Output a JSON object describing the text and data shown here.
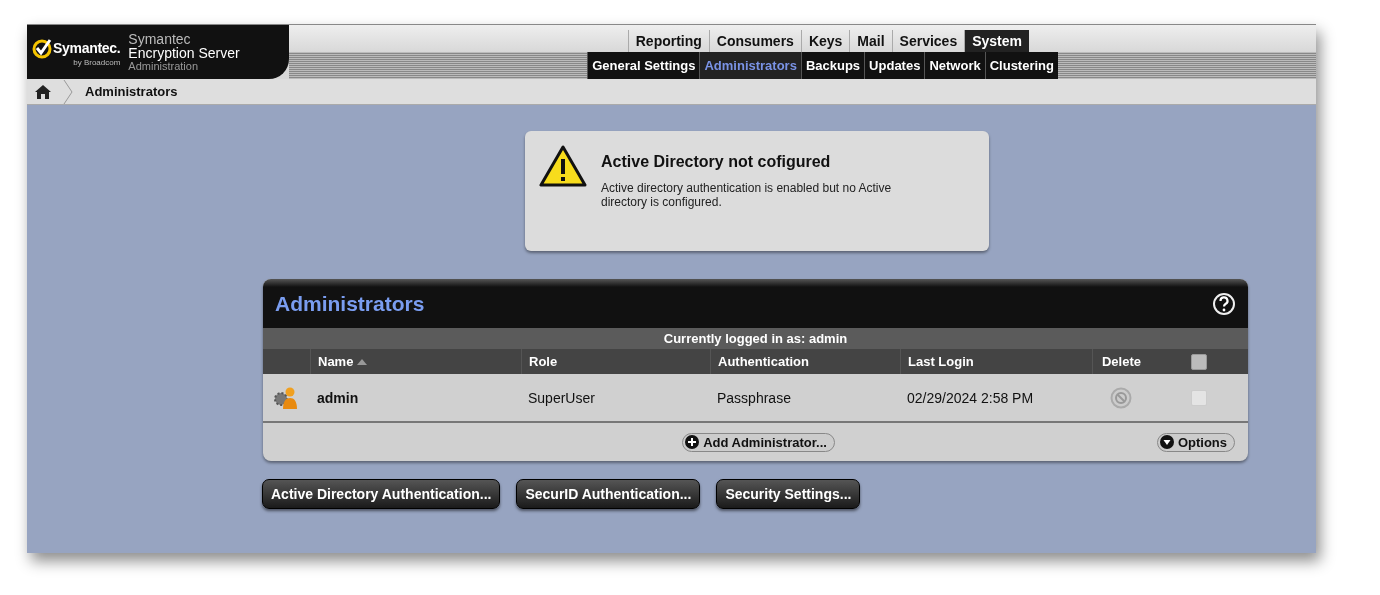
{
  "header": {
    "logo": {
      "brand": "Symantec.",
      "tagline": "by Broadcom"
    },
    "product": {
      "vendor": "Symantec",
      "name": "Encryption Server",
      "subtitle": "Administration"
    }
  },
  "tabs": [
    {
      "label": "Reporting",
      "selected": false
    },
    {
      "label": "Consumers",
      "selected": false
    },
    {
      "label": "Keys",
      "selected": false
    },
    {
      "label": "Mail",
      "selected": false
    },
    {
      "label": "Services",
      "selected": false
    },
    {
      "label": "System",
      "selected": true
    }
  ],
  "subtabs": [
    {
      "label": "General Settings",
      "selected": false
    },
    {
      "label": "Administrators",
      "selected": true
    },
    {
      "label": "Backups",
      "selected": false
    },
    {
      "label": "Updates",
      "selected": false
    },
    {
      "label": "Network",
      "selected": false
    },
    {
      "label": "Clustering",
      "selected": false
    }
  ],
  "breadcrumb": [
    "Administrators"
  ],
  "alert": {
    "title": "Active Directory not cofigured",
    "message": "Active directory authentication is enabled but no Active directory is configured."
  },
  "panel": {
    "title": "Administrators",
    "subtitle": "Currently logged in as: admin",
    "select_all_checked": false,
    "columns": [
      {
        "label": "Name",
        "sorted": true
      },
      {
        "label": "Role",
        "sorted": false
      },
      {
        "label": "Authentication",
        "sorted": false
      },
      {
        "label": "Last Login",
        "sorted": false
      },
      {
        "label": "Delete",
        "sorted": false
      }
    ],
    "rows": [
      {
        "name": "admin",
        "role": "SuperUser",
        "authentication": "Passphrase",
        "last_login": "02/29/2024 2:58 PM",
        "checked": false
      }
    ],
    "add_button": "Add Administrator...",
    "options_button": "Options"
  },
  "buttons": [
    "Active Directory Authentication...",
    "SecurID Authentication...",
    "Security Settings..."
  ]
}
